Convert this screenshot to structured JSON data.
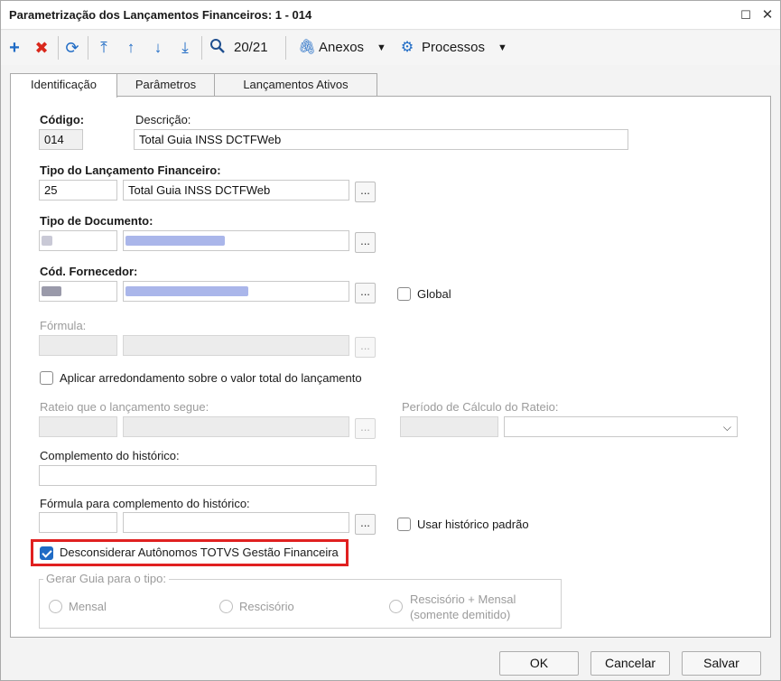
{
  "window": {
    "title": "Parametrização dos Lançamentos Financeiros: 1 - 014",
    "maximize_icon": "restore-icon",
    "close_icon": "close-icon"
  },
  "toolbar": {
    "record_position": "20/21",
    "attachments_label": "Anexos",
    "processes_label": "Processos",
    "add_color": "#1f6bc5",
    "delete_color": "#d9281c"
  },
  "tabs": [
    {
      "label": "Identificação",
      "active": true
    },
    {
      "label": "Parâmetros",
      "active": false
    },
    {
      "label": "Lançamentos Ativos",
      "active": false
    }
  ],
  "form": {
    "code_label": "Código:",
    "code_value": "014",
    "description_label": "Descrição:",
    "description_value": "Total Guia INSS DCTFWeb",
    "launch_type_label": "Tipo do Lançamento Financeiro:",
    "launch_type_code": "25",
    "launch_type_desc": "Total Guia INSS DCTFWeb",
    "doc_type_label": "Tipo de Documento:",
    "supplier_label": "Cód. Fornecedor:",
    "global_label": "Global",
    "formula_label": "Fórmula:",
    "rounding_label": "Aplicar arredondamento sobre o valor total do lançamento",
    "apportion_label": "Rateio que o lançamento segue:",
    "apportion_period_label": "Período de Cálculo do Rateio:",
    "history_complement_label": "Complemento do histórico:",
    "history_formula_label": "Fórmula para complemento do histórico:",
    "default_history_label": "Usar histórico padrão",
    "disregard_label": "Desconsiderar Autônomos TOTVS Gestão Financeira",
    "disregard_checked": true,
    "guide_group_label": "Gerar Guia para o tipo:",
    "guide_monthly": "Mensal",
    "guide_termination": "Rescisório",
    "guide_termination_monthly_1": "Rescisório + Mensal",
    "guide_termination_monthly_2": "(somente demitido)",
    "dots": "..."
  },
  "buttons": {
    "ok": "OK",
    "cancel": "Cancelar",
    "save": "Salvar"
  },
  "colors": {
    "highlight": "#e02020",
    "checkbox_on": "#1f6bc5"
  }
}
